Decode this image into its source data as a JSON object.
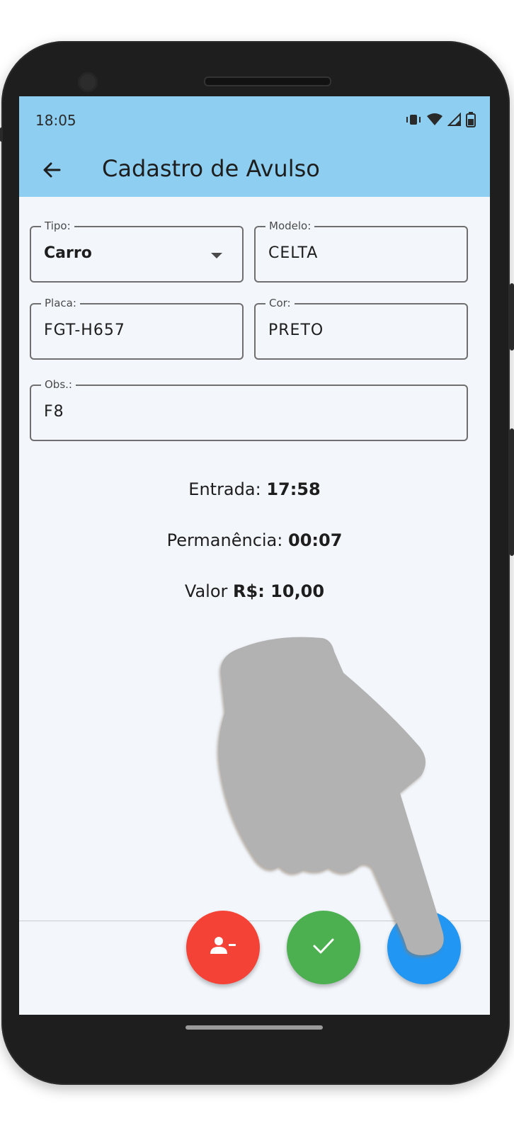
{
  "status_bar": {
    "time": "18:05"
  },
  "app_bar": {
    "title": "Cadastro de Avulso"
  },
  "form": {
    "tipo": {
      "label": "Tipo:",
      "value": "Carro"
    },
    "modelo": {
      "label": "Modelo:",
      "value": "CELTA"
    },
    "placa": {
      "label": "Placa:",
      "value": "FGT-H657"
    },
    "cor": {
      "label": "Cor:",
      "value": "PRETO"
    },
    "obs": {
      "label": "Obs.:",
      "value": "F8"
    }
  },
  "summary": {
    "entrada_label": "Entrada:",
    "entrada_value": "17:58",
    "permanencia_label": "Permanência:",
    "permanencia_value": "00:07",
    "valor_label": "Valor",
    "valor_value": "R$: 10,00"
  },
  "actions": {
    "remove_color": "#f44336",
    "confirm_color": "#4caf50",
    "third_color": "#2196f3"
  },
  "colors": {
    "app_bar": "#8ecff1",
    "background": "#f3f7fc"
  }
}
